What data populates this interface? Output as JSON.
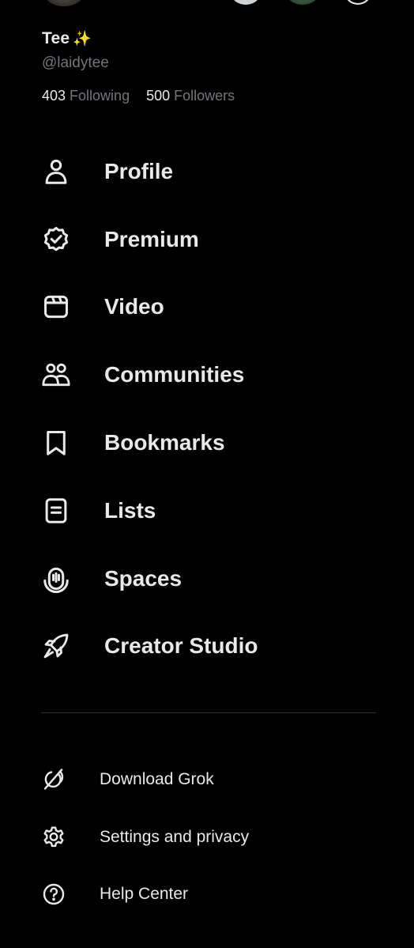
{
  "profile": {
    "display_name": "Tee",
    "name_emoji": "✨",
    "handle": "@laidytee",
    "following_count": "403",
    "following_label": "Following",
    "followers_count": "500",
    "followers_label": "Followers"
  },
  "nav": {
    "items": [
      {
        "label": "Profile",
        "icon": "person-icon"
      },
      {
        "label": "Premium",
        "icon": "verified-badge-icon"
      },
      {
        "label": "Video",
        "icon": "video-clapper-icon"
      },
      {
        "label": "Communities",
        "icon": "communities-icon"
      },
      {
        "label": "Bookmarks",
        "icon": "bookmark-icon"
      },
      {
        "label": "Lists",
        "icon": "list-icon"
      },
      {
        "label": "Spaces",
        "icon": "spaces-mic-icon"
      },
      {
        "label": "Creator Studio",
        "icon": "rocket-icon"
      }
    ]
  },
  "secondary": {
    "items": [
      {
        "label": "Download Grok",
        "icon": "grok-icon"
      },
      {
        "label": "Settings and privacy",
        "icon": "gear-icon"
      },
      {
        "label": "Help Center",
        "icon": "help-circle-icon"
      }
    ]
  },
  "colors": {
    "background": "#000000",
    "text_primary": "#e7e9ea",
    "text_secondary": "#71767b",
    "divider": "#2f3336",
    "sparkle": "#f4c430"
  }
}
